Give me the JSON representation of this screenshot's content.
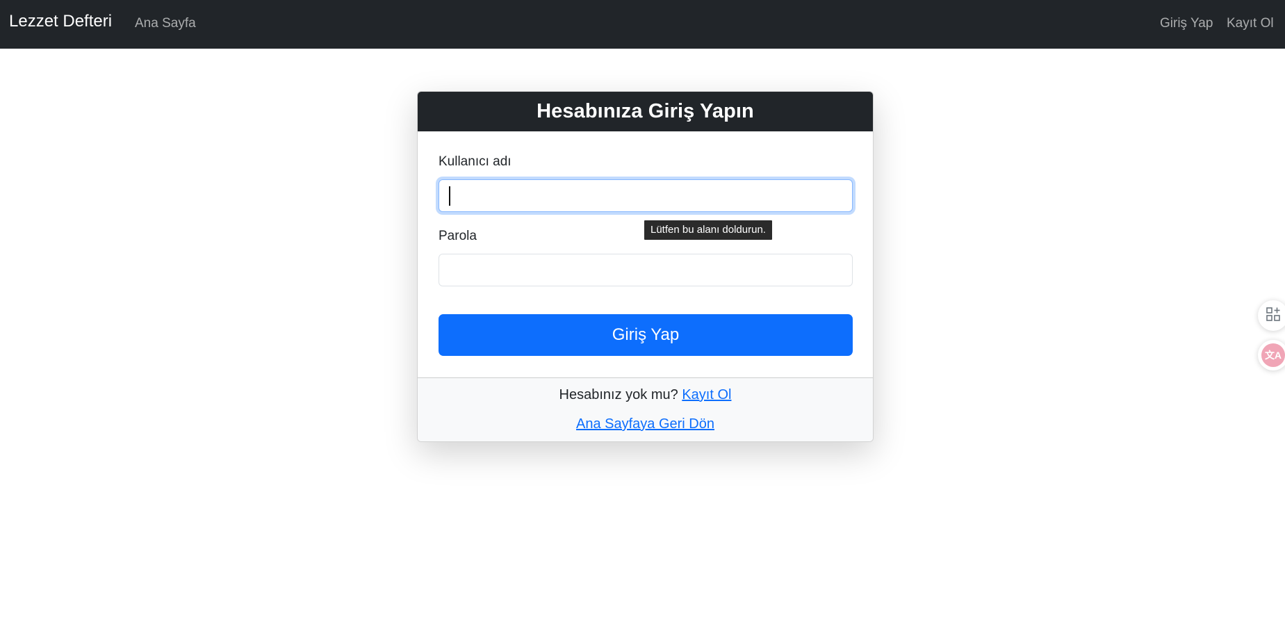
{
  "navbar": {
    "brand": "Lezzet Defteri",
    "home": "Ana Sayfa",
    "login": "Giriş Yap",
    "register": "Kayıt Ol"
  },
  "card": {
    "title": "Hesabınıza Giriş Yapın",
    "username_label": "Kullanıcı adı",
    "username_value": "",
    "password_label": "Parola",
    "password_value": "",
    "submit": "Giriş Yap",
    "footer": {
      "no_account": "Hesabınız yok mu?",
      "register_link": "Kayıt Ol",
      "home_link": "Ana Sayfaya Geri Dön"
    }
  },
  "tooltip": {
    "text": "Lütfen bu alanı doldurun."
  },
  "side_widgets": {
    "translate_glyph": "文A"
  },
  "colors": {
    "navbar_bg": "#212529",
    "primary": "#0d6efd",
    "footer_bg": "#f8f9fa"
  },
  "icons": [
    "apps-add-icon",
    "translate-icon"
  ]
}
